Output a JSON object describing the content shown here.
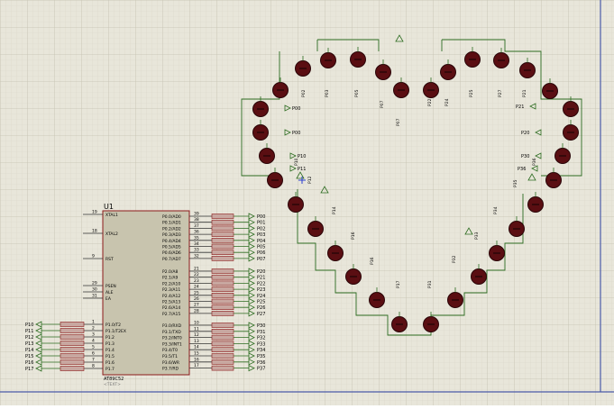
{
  "schematic": {
    "sheet_color": "#e8e6da",
    "grid_color": "#c9c6b8",
    "wire_color": "#2b6b1f",
    "led_color": "#5a0e12",
    "chip_fill": "#c8c4ae",
    "chip_border": "#8b1a1a",
    "label_color": "#000080",
    "chip": {
      "ref": "U1",
      "part": "AT89C52",
      "part_sub": "<TEXT>",
      "left_pins": [
        {
          "num": "19",
          "name": "XTAL1"
        },
        {
          "num": "18",
          "name": "XTAL2"
        },
        {
          "num": "9",
          "name": "RST"
        },
        {
          "num": "29",
          "name": "PSEN"
        },
        {
          "num": "30",
          "name": "ALE"
        },
        {
          "num": "31",
          "name": "EA"
        },
        {
          "num": "1",
          "name": "P1.0/T2"
        },
        {
          "num": "2",
          "name": "P1.1/T2EX"
        },
        {
          "num": "3",
          "name": "P1.2"
        },
        {
          "num": "4",
          "name": "P1.3"
        },
        {
          "num": "5",
          "name": "P1.4"
        },
        {
          "num": "6",
          "name": "P1.5"
        },
        {
          "num": "7",
          "name": "P1.6"
        },
        {
          "num": "8",
          "name": "P1.7"
        }
      ],
      "port0": [
        {
          "num": "39",
          "name": "P0.0/AD0",
          "net": "P00"
        },
        {
          "num": "38",
          "name": "P0.1/AD1",
          "net": "P01"
        },
        {
          "num": "37",
          "name": "P0.2/AD2",
          "net": "P02"
        },
        {
          "num": "36",
          "name": "P0.3/AD3",
          "net": "P03"
        },
        {
          "num": "35",
          "name": "P0.4/AD4",
          "net": "P04"
        },
        {
          "num": "34",
          "name": "P0.5/AD5",
          "net": "P05"
        },
        {
          "num": "33",
          "name": "P0.6/AD6",
          "net": "P06"
        },
        {
          "num": "32",
          "name": "P0.7/AD7",
          "net": "P07"
        }
      ],
      "port2": [
        {
          "num": "21",
          "name": "P2.0/A8",
          "net": "P20"
        },
        {
          "num": "22",
          "name": "P2.1/A9",
          "net": "P21"
        },
        {
          "num": "23",
          "name": "P2.2/A10",
          "net": "P22"
        },
        {
          "num": "24",
          "name": "P2.3/A11",
          "net": "P23"
        },
        {
          "num": "25",
          "name": "P2.4/A12",
          "net": "P24"
        },
        {
          "num": "26",
          "name": "P2.5/A13",
          "net": "P25"
        },
        {
          "num": "27",
          "name": "P2.6/A14",
          "net": "P26"
        },
        {
          "num": "28",
          "name": "P2.7/A15",
          "net": "P27"
        }
      ],
      "port3": [
        {
          "num": "10",
          "name": "P3.0/RXD",
          "net": "P30"
        },
        {
          "num": "11",
          "name": "P3.1/TXD",
          "net": "P31"
        },
        {
          "num": "12",
          "name": "P3.2/INT0",
          "net": "P32"
        },
        {
          "num": "13",
          "name": "P3.3/INT1",
          "net": "P33"
        },
        {
          "num": "14",
          "name": "P3.4/T0",
          "net": "P34"
        },
        {
          "num": "15",
          "name": "P3.5/T1",
          "net": "P35"
        },
        {
          "num": "16",
          "name": "P3.6/WR",
          "net": "P36"
        },
        {
          "num": "17",
          "name": "P3.7/RD",
          "net": "P37"
        }
      ],
      "port1_nets": [
        "P10",
        "P11",
        "P12",
        "P13",
        "P14",
        "P15",
        "P16",
        "P17"
      ]
    },
    "heart_labels": {
      "P00": "P00",
      "P02": "P02",
      "P10": "P10",
      "P11": "P11",
      "P12": "P12",
      "P14": "P14",
      "P16": "P16",
      "P17": "P17",
      "P20": "P20",
      "P21": "P21",
      "P30": "P30",
      "P36": "P36",
      "P33": "P33",
      "P31": "P31",
      "P35": "P35",
      "P25": "P25",
      "P03": "P03",
      "P05": "P05",
      "P07": "P07",
      "P22": "P22",
      "P24": "P24",
      "P27": "P27",
      "P32": "P32",
      "P34": "P34"
    }
  }
}
